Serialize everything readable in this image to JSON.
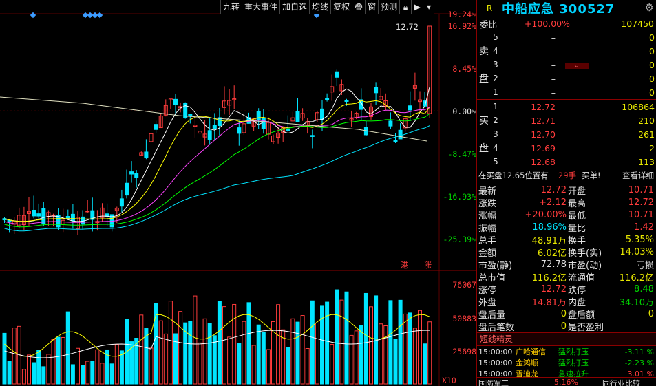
{
  "toolbar": {
    "items": [
      "九转",
      "重大事件",
      "加自选",
      "均线",
      "复权",
      "叠",
      "窗",
      "预测"
    ],
    "icons": [
      "lock-icon",
      "panel-toggle-icon",
      "dropdown-icon"
    ]
  },
  "axis": {
    "price_pct": [
      "19.24%",
      "16.92%",
      "8.45%",
      "0.00%",
      "-8.47%",
      "-16.93%",
      "-25.39%"
    ],
    "volume": [
      "76067",
      "50883",
      "25698"
    ],
    "volume_unit": "X10"
  },
  "markers": {
    "last_price_label": "12.72",
    "tag_hk": "港",
    "tag_zhang": "涨"
  },
  "title": {
    "r_label": "R",
    "name": "中船应急 300527"
  },
  "weibi": {
    "label": "委比",
    "pct": "+100.00%",
    "value": "107450"
  },
  "sell_side": {
    "label": "卖\n盘",
    "rows": [
      {
        "n": "5",
        "price": "–",
        "vol": "0"
      },
      {
        "n": "4",
        "price": "–",
        "vol": "0"
      },
      {
        "n": "3",
        "price": "–",
        "vol": "0"
      },
      {
        "n": "2",
        "price": "–",
        "vol": "0"
      },
      {
        "n": "1",
        "price": "–",
        "vol": "0"
      }
    ]
  },
  "buy_side": {
    "label": "买\n盘",
    "rows": [
      {
        "n": "1",
        "price": "12.72",
        "vol": "106864"
      },
      {
        "n": "2",
        "price": "12.71",
        "vol": "210"
      },
      {
        "n": "3",
        "price": "12.70",
        "vol": "261"
      },
      {
        "n": "4",
        "price": "12.69",
        "vol": "2"
      },
      {
        "n": "5",
        "price": "12.68",
        "vol": "113"
      }
    ]
  },
  "ops": {
    "text": "在买盘12.65位置有",
    "qty": "29手",
    "buy": "买单!",
    "detail": "查看详细"
  },
  "stats": [
    [
      "最新",
      "12.72",
      "开盘",
      "10.71"
    ],
    [
      "涨跌",
      "+2.12",
      "最高",
      "12.72"
    ],
    [
      "涨幅",
      "+20.00%",
      "最低",
      "10.71"
    ],
    [
      "振幅",
      "18.96%",
      "量比",
      "1.42"
    ],
    [
      "总手",
      "48.91万",
      "换手",
      "5.35%"
    ],
    [
      "金额",
      "6.02亿",
      "换手(实)",
      "14.03%"
    ],
    [
      "市盈(静)",
      "72.78",
      "市盈(动)",
      "亏损"
    ],
    [
      "总市值",
      "116.2亿",
      "流通值",
      "116.2亿"
    ],
    [
      "涨停",
      "12.72",
      "跌停",
      "8.48"
    ],
    [
      "外盘",
      "14.81万",
      "内盘",
      "34.10万"
    ],
    [
      "盘后量",
      "0",
      "盘后额",
      "0"
    ],
    [
      "盘后笔数",
      "0",
      "是否盈利",
      ""
    ]
  ],
  "flash": {
    "header": "短线精灵",
    "rows": [
      {
        "time": "15:00:00",
        "name": "广哈通信",
        "event": "猛烈打压",
        "pct": "-3.11 %"
      },
      {
        "time": "15:00:00",
        "name": "金鸿顺",
        "event": "猛烈打压",
        "pct": "-2.23 %"
      },
      {
        "time": "15:00:00",
        "name": "雪迪龙",
        "event": "急速拉升",
        "pct": "3.01 %"
      }
    ]
  },
  "bottom": {
    "left": "国防军工",
    "pct": "5.16%",
    "right": "同行业比较"
  },
  "colors": {
    "up": "#ff3c3c",
    "down": "#00e5ff",
    "ma5": "#ffffff",
    "ma10": "#ffff00",
    "ma20": "#ff44ff",
    "ma30": "#00ff00",
    "ma60": "#00e5ff",
    "ma250": "#e0e0c0"
  }
}
